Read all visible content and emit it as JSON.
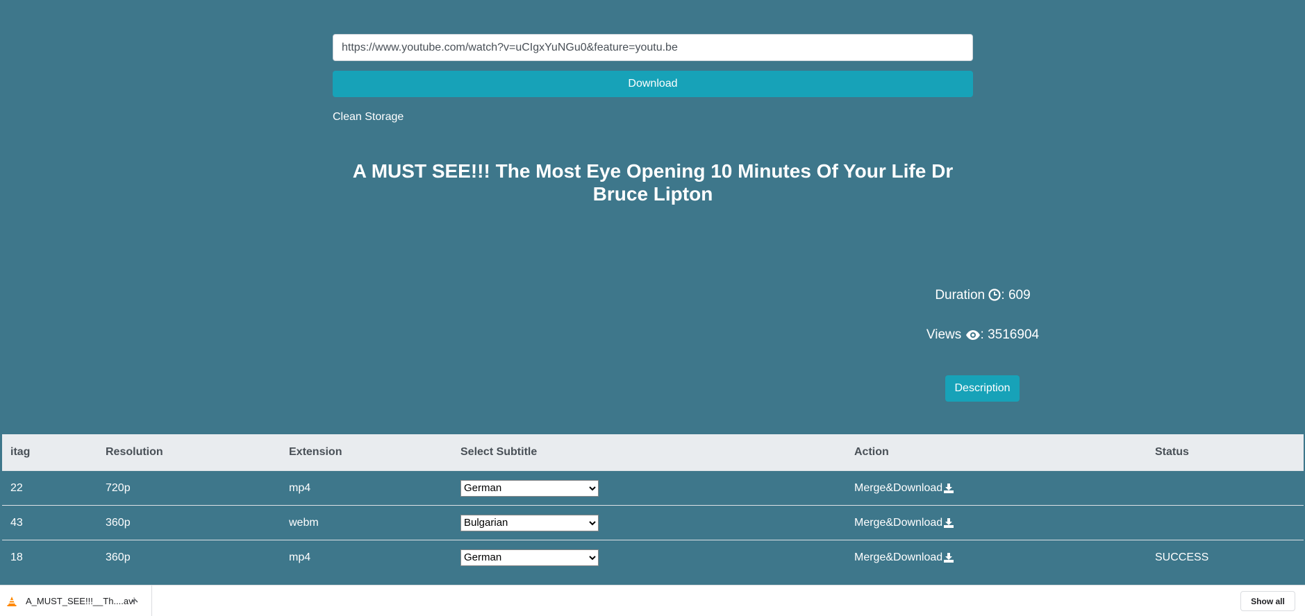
{
  "form": {
    "url_value": "https://www.youtube.com/watch?v=uCIgxYuNGu0&feature=youtu.be",
    "download_label": "Download",
    "clean_storage_label": "Clean Storage"
  },
  "video": {
    "title": "A MUST SEE!!! The Most Eye Opening 10 Minutes Of Your Life Dr Bruce Lipton",
    "duration_label": "Duration",
    "duration_value": ": 609",
    "views_label": "Views",
    "views_value": ": 3516904",
    "description_label": "Description"
  },
  "formats_table": {
    "headers": [
      "itag",
      "Resolution",
      "Extension",
      "Select Subtitle",
      "Action",
      "Status"
    ],
    "rows": [
      {
        "itag": "22",
        "resolution": "720p",
        "extension": "mp4",
        "subtitle": "German",
        "action": "Merge&Download",
        "status": ""
      },
      {
        "itag": "43",
        "resolution": "360p",
        "extension": "webm",
        "subtitle": "Bulgarian",
        "action": "Merge&Download",
        "status": ""
      },
      {
        "itag": "18",
        "resolution": "360p",
        "extension": "mp4",
        "subtitle": "German",
        "action": "Merge&Download",
        "status": "SUCCESS"
      }
    ]
  },
  "download_bar": {
    "file_name": "A_MUST_SEE!!!__Th....avi",
    "show_all_label": "Show all",
    "file_icon": "vlc-cone-icon"
  },
  "colors": {
    "page_background": "#3e778b",
    "accent_button": "#17a2b8",
    "table_header_background": "#e9ecef"
  }
}
